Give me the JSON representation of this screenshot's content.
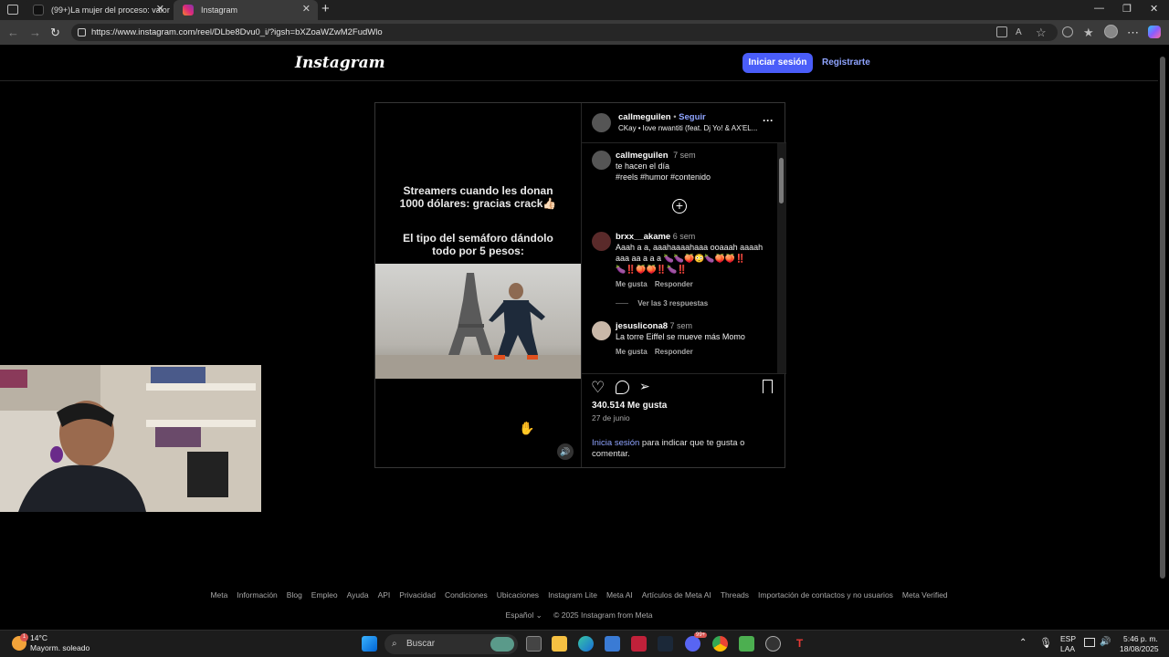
{
  "browser": {
    "tabs": [
      {
        "label": "(99+)La mujer del proceso: valor",
        "active": false
      },
      {
        "label": "Instagram",
        "active": true
      }
    ],
    "url": "https://www.instagram.com/reel/DLbe8Dvu0_i/?igsh=bXZoaWZwM2FudWlo"
  },
  "header": {
    "logo": "Instagram",
    "login_label": "Iniciar sesión",
    "register_label": "Registrarte"
  },
  "post": {
    "overlay_text_1": [
      "Streamers cuando les donan",
      "1000 dólares: gracias crack👍🏻"
    ],
    "overlay_text_2": [
      "El tipo del semáforo dándolo",
      "todo por 5 pesos:"
    ],
    "author": "callmeguilen",
    "follow_label": "Seguir",
    "separator": "•",
    "audio": "CKay • love nwantiti (feat. Dj Yo! & AX'EL...",
    "caption": {
      "username": "callmeguilen",
      "time": "7 sem",
      "text": "te hacen el día",
      "hashtags": "#reels #humor #contenido"
    },
    "comments": [
      {
        "username": "brxx__akame",
        "time": "6 sem",
        "text_line1": "Aaah a a, aaahaaaahaaa ooaaah aaaah",
        "text_line2": "aaa aa a a a 🍆🍆🍑😳🍆🍑🍑‼️",
        "text_line3": "🍆‼️🍑🍑‼️🍆‼️",
        "like_label": "Me gusta",
        "reply_label": "Responder",
        "view_replies": "Ver las 3 respuestas"
      },
      {
        "username": "jesuslicona8",
        "time": "7 sem",
        "text_line1": "La torre Eiffel se mueve más Momo",
        "like_label": "Me gusta",
        "reply_label": "Responder"
      }
    ],
    "likes": "340.514 Me gusta",
    "date": "27 de junio",
    "login_prompt_link": "Inicia sesión",
    "login_prompt_rest": " para indicar que te gusta o",
    "login_prompt_line2": "comentar."
  },
  "footer": {
    "links": [
      "Meta",
      "Información",
      "Blog",
      "Empleo",
      "Ayuda",
      "API",
      "Privacidad",
      "Condiciones",
      "Ubicaciones",
      "Instagram Lite",
      "Meta AI",
      "Artículos de Meta AI",
      "Threads",
      "Importación de contactos y no usuarios",
      "Meta Verified"
    ],
    "language": "Español",
    "copyright": "© 2025 Instagram from Meta"
  },
  "taskbar": {
    "temperature": "14°C",
    "weather": "Mayorm. soleado",
    "search_placeholder": "Buscar",
    "lang_top": "ESP",
    "lang_bottom": "LAA",
    "time": "5:46 p. m.",
    "date": "18/08/2025",
    "notification_badge": "99+"
  },
  "colors": {
    "accent": "#4a5df9",
    "link": "#8fa4ff",
    "background": "#000000"
  }
}
